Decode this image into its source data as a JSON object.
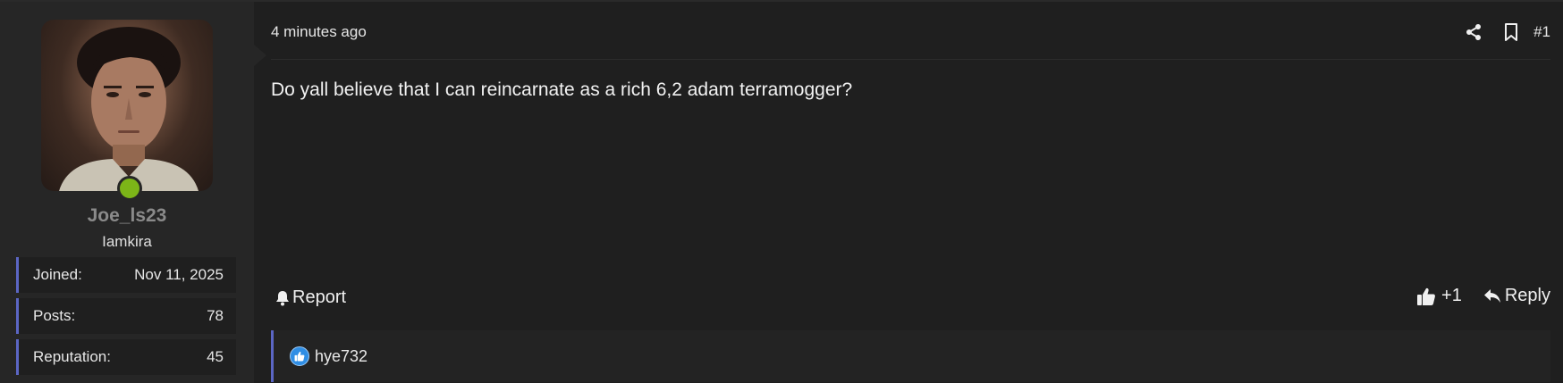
{
  "user": {
    "username": "Joe_ls23",
    "title": "Iamkira",
    "online": true,
    "stats": [
      {
        "label": "Joined:",
        "value": "Nov 11, 2025"
      },
      {
        "label": "Posts:",
        "value": "78"
      },
      {
        "label": "Reputation:",
        "value": "45"
      }
    ]
  },
  "post": {
    "time": "4 minutes ago",
    "number": "#1",
    "message": "Do yall believe that I can reincarnate as a rich 6,2 adam terramogger?",
    "report_label": "Report",
    "like_count": "+1",
    "reply_label": "Reply",
    "reactions": {
      "users": "hye732"
    }
  },
  "icons": {
    "share": "share-icon",
    "bookmark": "bookmark-icon",
    "bell": "bell-icon",
    "thumbs_up": "thumbs-up-icon",
    "reply": "reply-icon",
    "like_reaction": "like-reaction-icon"
  },
  "colors": {
    "accent": "#5b66c4",
    "online": "#7cb518",
    "like_badge": "#2f8ee5",
    "background": "#1f1f1f",
    "sidebar": "#262626"
  }
}
